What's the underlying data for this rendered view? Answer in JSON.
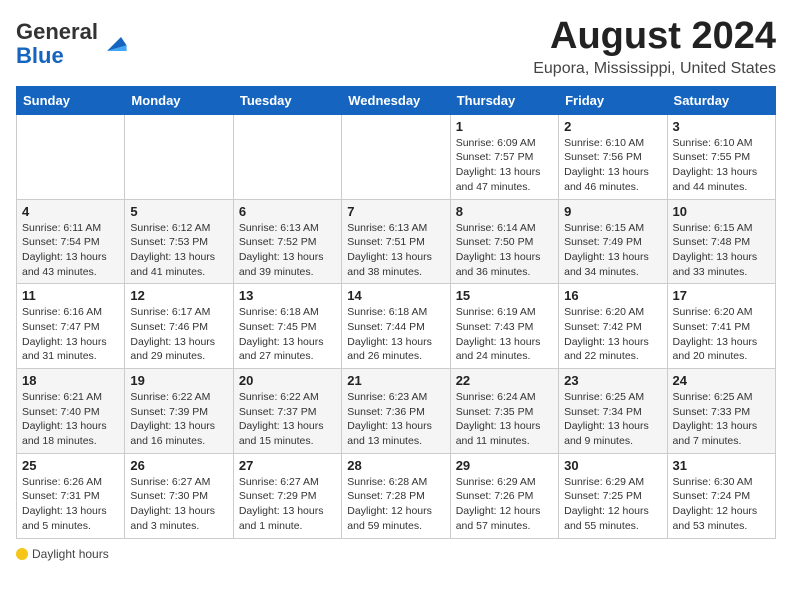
{
  "logo": {
    "general": "General",
    "blue": "Blue"
  },
  "title": "August 2024",
  "subtitle": "Eupora, Mississippi, United States",
  "weekdays": [
    "Sunday",
    "Monday",
    "Tuesday",
    "Wednesday",
    "Thursday",
    "Friday",
    "Saturday"
  ],
  "weeks": [
    [
      {
        "day": "",
        "info": ""
      },
      {
        "day": "",
        "info": ""
      },
      {
        "day": "",
        "info": ""
      },
      {
        "day": "",
        "info": ""
      },
      {
        "day": "1",
        "info": "Sunrise: 6:09 AM\nSunset: 7:57 PM\nDaylight: 13 hours and 47 minutes."
      },
      {
        "day": "2",
        "info": "Sunrise: 6:10 AM\nSunset: 7:56 PM\nDaylight: 13 hours and 46 minutes."
      },
      {
        "day": "3",
        "info": "Sunrise: 6:10 AM\nSunset: 7:55 PM\nDaylight: 13 hours and 44 minutes."
      }
    ],
    [
      {
        "day": "4",
        "info": "Sunrise: 6:11 AM\nSunset: 7:54 PM\nDaylight: 13 hours and 43 minutes."
      },
      {
        "day": "5",
        "info": "Sunrise: 6:12 AM\nSunset: 7:53 PM\nDaylight: 13 hours and 41 minutes."
      },
      {
        "day": "6",
        "info": "Sunrise: 6:13 AM\nSunset: 7:52 PM\nDaylight: 13 hours and 39 minutes."
      },
      {
        "day": "7",
        "info": "Sunrise: 6:13 AM\nSunset: 7:51 PM\nDaylight: 13 hours and 38 minutes."
      },
      {
        "day": "8",
        "info": "Sunrise: 6:14 AM\nSunset: 7:50 PM\nDaylight: 13 hours and 36 minutes."
      },
      {
        "day": "9",
        "info": "Sunrise: 6:15 AM\nSunset: 7:49 PM\nDaylight: 13 hours and 34 minutes."
      },
      {
        "day": "10",
        "info": "Sunrise: 6:15 AM\nSunset: 7:48 PM\nDaylight: 13 hours and 33 minutes."
      }
    ],
    [
      {
        "day": "11",
        "info": "Sunrise: 6:16 AM\nSunset: 7:47 PM\nDaylight: 13 hours and 31 minutes."
      },
      {
        "day": "12",
        "info": "Sunrise: 6:17 AM\nSunset: 7:46 PM\nDaylight: 13 hours and 29 minutes."
      },
      {
        "day": "13",
        "info": "Sunrise: 6:18 AM\nSunset: 7:45 PM\nDaylight: 13 hours and 27 minutes."
      },
      {
        "day": "14",
        "info": "Sunrise: 6:18 AM\nSunset: 7:44 PM\nDaylight: 13 hours and 26 minutes."
      },
      {
        "day": "15",
        "info": "Sunrise: 6:19 AM\nSunset: 7:43 PM\nDaylight: 13 hours and 24 minutes."
      },
      {
        "day": "16",
        "info": "Sunrise: 6:20 AM\nSunset: 7:42 PM\nDaylight: 13 hours and 22 minutes."
      },
      {
        "day": "17",
        "info": "Sunrise: 6:20 AM\nSunset: 7:41 PM\nDaylight: 13 hours and 20 minutes."
      }
    ],
    [
      {
        "day": "18",
        "info": "Sunrise: 6:21 AM\nSunset: 7:40 PM\nDaylight: 13 hours and 18 minutes."
      },
      {
        "day": "19",
        "info": "Sunrise: 6:22 AM\nSunset: 7:39 PM\nDaylight: 13 hours and 16 minutes."
      },
      {
        "day": "20",
        "info": "Sunrise: 6:22 AM\nSunset: 7:37 PM\nDaylight: 13 hours and 15 minutes."
      },
      {
        "day": "21",
        "info": "Sunrise: 6:23 AM\nSunset: 7:36 PM\nDaylight: 13 hours and 13 minutes."
      },
      {
        "day": "22",
        "info": "Sunrise: 6:24 AM\nSunset: 7:35 PM\nDaylight: 13 hours and 11 minutes."
      },
      {
        "day": "23",
        "info": "Sunrise: 6:25 AM\nSunset: 7:34 PM\nDaylight: 13 hours and 9 minutes."
      },
      {
        "day": "24",
        "info": "Sunrise: 6:25 AM\nSunset: 7:33 PM\nDaylight: 13 hours and 7 minutes."
      }
    ],
    [
      {
        "day": "25",
        "info": "Sunrise: 6:26 AM\nSunset: 7:31 PM\nDaylight: 13 hours and 5 minutes."
      },
      {
        "day": "26",
        "info": "Sunrise: 6:27 AM\nSunset: 7:30 PM\nDaylight: 13 hours and 3 minutes."
      },
      {
        "day": "27",
        "info": "Sunrise: 6:27 AM\nSunset: 7:29 PM\nDaylight: 13 hours and 1 minute."
      },
      {
        "day": "28",
        "info": "Sunrise: 6:28 AM\nSunset: 7:28 PM\nDaylight: 12 hours and 59 minutes."
      },
      {
        "day": "29",
        "info": "Sunrise: 6:29 AM\nSunset: 7:26 PM\nDaylight: 12 hours and 57 minutes."
      },
      {
        "day": "30",
        "info": "Sunrise: 6:29 AM\nSunset: 7:25 PM\nDaylight: 12 hours and 55 minutes."
      },
      {
        "day": "31",
        "info": "Sunrise: 6:30 AM\nSunset: 7:24 PM\nDaylight: 12 hours and 53 minutes."
      }
    ]
  ],
  "footer": {
    "daylight_label": "Daylight hours"
  }
}
